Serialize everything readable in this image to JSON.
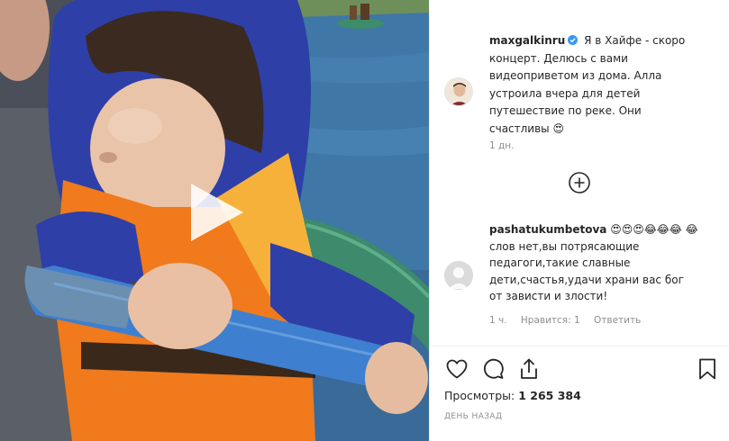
{
  "post": {
    "username": "maxgalkinru",
    "caption": "Я в Хайфе - скоро концерт. Делюсь с вами видеоприветом из дома. Алла устроила вчера для детей путешествие по реке. Они счастливы 😍",
    "time": "1 дн."
  },
  "comment": {
    "username": "pashatukumbetova",
    "text": "😍😍😍😂😂😂 😂слов нет,вы потрясающие педагоги,такие славные дети,счастья,удачи храни вас бог от зависти и злости!",
    "time": "1 ч.",
    "likes_label": "Нравится: 1",
    "reply_label": "Ответить"
  },
  "stats": {
    "views_label": "Просмотры:",
    "views_count": "1 265 384",
    "date": "ДЕНЬ НАЗАД"
  },
  "icons": {
    "play": "play-icon",
    "verified": "verified-badge-icon",
    "load_more": "plus-circle-icon",
    "like": "heart-icon",
    "comment": "comment-bubble-icon",
    "share": "share-icon",
    "save": "bookmark-icon"
  },
  "colors": {
    "verified": "#3897f0",
    "secondary_text": "#8e8e8e",
    "primary_text": "#262626"
  }
}
